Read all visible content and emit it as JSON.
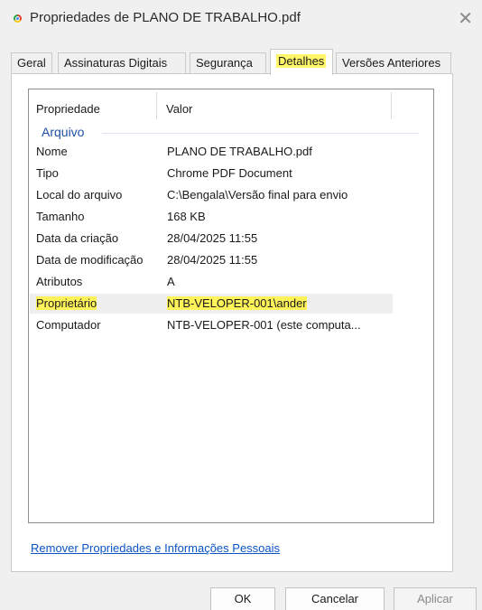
{
  "window": {
    "title": "Propriedades de PLANO DE TRABALHO.pdf",
    "close_glyph": "✕"
  },
  "tabs": [
    {
      "label": "Geral"
    },
    {
      "label": "Assinaturas Digitais"
    },
    {
      "label": "Segurança"
    },
    {
      "label": "Detalhes",
      "active": true
    },
    {
      "label": "Versões Anteriores"
    }
  ],
  "details": {
    "columns": {
      "property": "Propriedade",
      "value": "Valor"
    },
    "group_label": "Arquivo",
    "rows": [
      {
        "name": "Nome",
        "value": "PLANO DE TRABALHO.pdf"
      },
      {
        "name": "Tipo",
        "value": "Chrome PDF Document"
      },
      {
        "name": "Local do arquivo",
        "value": "C:\\Bengala\\Versão final para envio"
      },
      {
        "name": "Tamanho",
        "value": "168 KB"
      },
      {
        "name": "Data da criação",
        "value": "28/04/2025 11:55"
      },
      {
        "name": "Data de modificação",
        "value": "28/04/2025 11:55"
      },
      {
        "name": "Atributos",
        "value": "A"
      },
      {
        "name": "Proprietário",
        "value": "NTB-VELOPER-001\\ander",
        "selected": true,
        "highlighted": true
      },
      {
        "name": "Computador",
        "value": "NTB-VELOPER-001 (este computa..."
      }
    ],
    "remove_link": "Remover Propriedades e Informações Pessoais"
  },
  "buttons": {
    "ok": "OK",
    "cancel": "Cancelar",
    "apply": "Aplicar"
  },
  "icons": {
    "window_icon": "chrome-pdf-icon",
    "close": "close-icon"
  },
  "colors": {
    "highlight": "#fff35a",
    "link": "#0b55c4",
    "group_header": "#1e4fa3"
  }
}
